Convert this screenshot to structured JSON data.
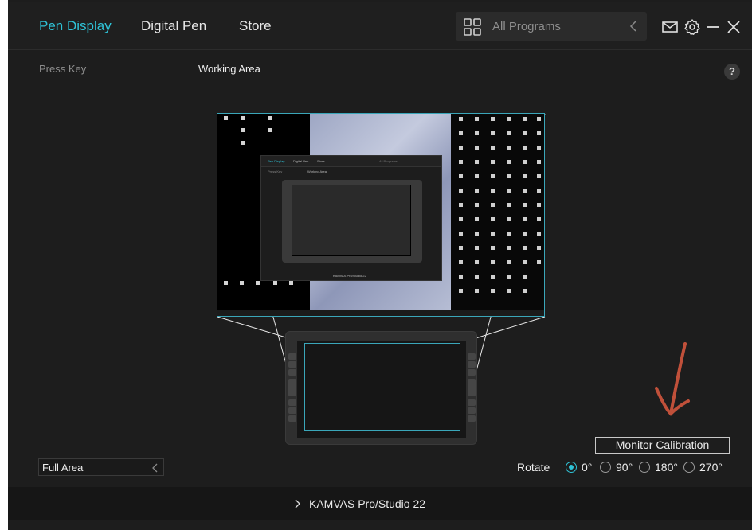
{
  "nav": {
    "tabs": [
      {
        "label": "Pen Display",
        "active": true
      },
      {
        "label": "Digital Pen",
        "active": false
      },
      {
        "label": "Store",
        "active": false
      }
    ]
  },
  "program_selector": {
    "label": "All Programs",
    "icon": "grid-icon"
  },
  "header_icons": [
    "mail-icon",
    "gear-icon",
    "minimize-icon",
    "close-icon"
  ],
  "subtabs": [
    {
      "label": "Press Key",
      "active": false
    },
    {
      "label": "Working Area",
      "active": true
    }
  ],
  "help": {
    "label": "?"
  },
  "area_select": {
    "value": "Full Area"
  },
  "calibration": {
    "label": "Monitor Calibration"
  },
  "rotate": {
    "label": "Rotate",
    "options": [
      {
        "label": "0°",
        "selected": true
      },
      {
        "label": "90°",
        "selected": false
      },
      {
        "label": "180°",
        "selected": false
      },
      {
        "label": "270°",
        "selected": false
      }
    ]
  },
  "device": {
    "name": "KAMVAS Pro/Studio 22"
  },
  "colors": {
    "accent": "#2fc3d7",
    "background": "#1d1d1d",
    "annotation_arrow": "#c0503a"
  }
}
